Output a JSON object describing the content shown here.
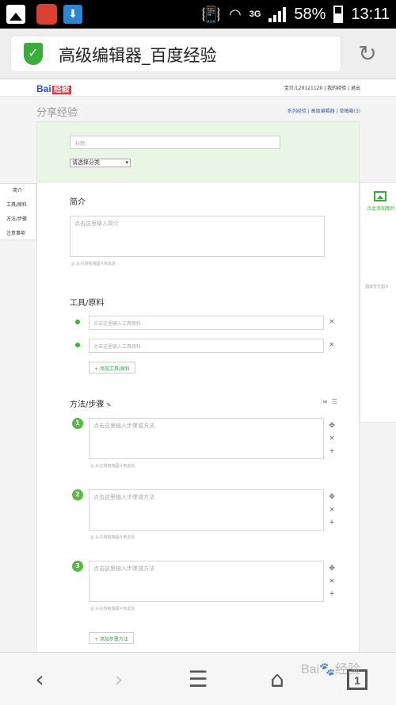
{
  "status_bar": {
    "network": "3G",
    "battery": "58%",
    "time": "13:11"
  },
  "browser": {
    "page_title": "高级编辑器_百度经验"
  },
  "site": {
    "logo_text": "Bai",
    "logo_suffix": "经验",
    "user_links": "宝贝儿20121120 | 我的经验 | 退出",
    "page_heading": "分享经验",
    "top_links": "系列经验 | 高级编辑器 | 草稿箱(3)"
  },
  "form": {
    "title_placeholder": "标题：",
    "category_selected": "请选择分类",
    "intro": {
      "heading": "简介",
      "placeholder": "点击这里输入简介",
      "image_hint": "从右侧拖拽图片到此处"
    },
    "tools": {
      "heading": "工具/原料",
      "items": [
        "点击这里输入工具原料",
        "点击这里输入工具原料"
      ],
      "add_label": "+ 添加工具/原料"
    },
    "steps": {
      "heading": "方法/步骤",
      "items": [
        {
          "num": "1",
          "placeholder": "点击这里输入步骤或方法",
          "image_hint": "从右侧拖拽图片到此处"
        },
        {
          "num": "2",
          "placeholder": "点击这里输入步骤或方法",
          "image_hint": "从右侧拖拽图片到此处"
        },
        {
          "num": "3",
          "placeholder": "点击这里输入步骤或方法",
          "image_hint": "从右侧拖拽图片到此处"
        }
      ],
      "add_label": "+ 添加步骤方法"
    }
  },
  "left_nav": [
    "简介",
    "工具/原料",
    "方法/步骤",
    "注意事项"
  ],
  "right_panel": {
    "label": "点此添加图片",
    "hint": "图库暂无图片"
  },
  "bottom_bar": {
    "tab_count": "1"
  },
  "watermark": "Bai🐾经验"
}
